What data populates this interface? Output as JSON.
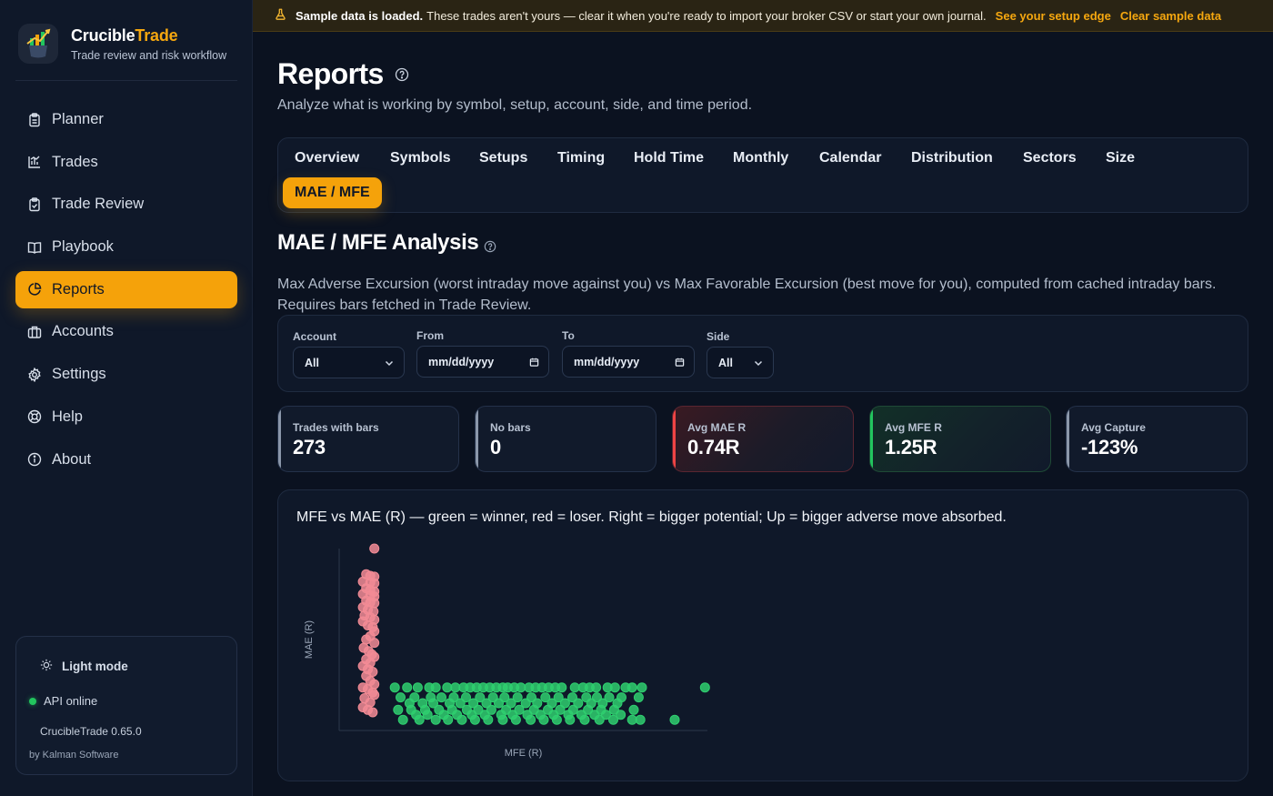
{
  "app": {
    "name_part1": "Crucible",
    "name_part2": "Trade",
    "tagline": "Trade review and risk workflow",
    "accent": "#f5a20a"
  },
  "sidebar": {
    "items": [
      {
        "label": "Planner",
        "icon": "clipboard-icon",
        "active": false
      },
      {
        "label": "Trades",
        "icon": "bar-chart-icon",
        "active": false
      },
      {
        "label": "Trade Review",
        "icon": "clipboard-check-icon",
        "active": false
      },
      {
        "label": "Playbook",
        "icon": "book-icon",
        "active": false
      },
      {
        "label": "Reports",
        "icon": "pie-chart-icon",
        "active": true
      },
      {
        "label": "Accounts",
        "icon": "briefcase-icon",
        "active": false
      },
      {
        "label": "Settings",
        "icon": "gear-icon",
        "active": false
      },
      {
        "label": "Help",
        "icon": "lifebuoy-icon",
        "active": false
      },
      {
        "label": "About",
        "icon": "info-icon",
        "active": false
      }
    ],
    "footer": {
      "light_mode": "Light mode",
      "api_status": "API online",
      "version": "CrucibleTrade 0.65.0",
      "byline": "by Kalman Software"
    }
  },
  "banner": {
    "bold": "Sample data is loaded.",
    "text": "These trades aren't yours — clear it when you're ready to import your broker CSV or start your own journal.",
    "link1": "See your setup edge",
    "link2": "Clear sample data"
  },
  "page": {
    "title": "Reports",
    "subtitle": "Analyze what is working by symbol, setup, account, side, and time period."
  },
  "tabs": [
    {
      "label": "Overview"
    },
    {
      "label": "Symbols"
    },
    {
      "label": "Setups"
    },
    {
      "label": "Timing"
    },
    {
      "label": "Hold Time"
    },
    {
      "label": "Monthly"
    },
    {
      "label": "Calendar"
    },
    {
      "label": "Distribution"
    },
    {
      "label": "Sectors"
    },
    {
      "label": "Size"
    },
    {
      "label": "MAE / MFE",
      "active": true
    }
  ],
  "section": {
    "title": "MAE / MFE Analysis",
    "description": "Max Adverse Excursion (worst intraday move against you) vs Max Favorable Excursion (best move for you), computed from cached intraday bars. Requires bars fetched in Trade Review."
  },
  "filters": {
    "account": {
      "label": "Account",
      "value": "All"
    },
    "from": {
      "label": "From",
      "placeholder": "mm/dd/yyyy"
    },
    "to": {
      "label": "To",
      "placeholder": "mm/dd/yyyy"
    },
    "side": {
      "label": "Side",
      "value": "All"
    }
  },
  "stats": [
    {
      "label": "Trades with bars",
      "value": "273",
      "tone": "neutral"
    },
    {
      "label": "No bars",
      "value": "0",
      "tone": "neutral"
    },
    {
      "label": "Avg MAE R",
      "value": "0.74R",
      "tone": "red"
    },
    {
      "label": "Avg MFE R",
      "value": "1.25R",
      "tone": "green"
    },
    {
      "label": "Avg Capture",
      "value": "-123%",
      "tone": "neutral"
    }
  ],
  "chart_data": {
    "type": "scatter",
    "title": "MFE vs MAE (R) — green = winner, red = loser. Right = bigger potential; Up = bigger adverse move absorbed.",
    "xlabel": "MFE (R)",
    "ylabel": "MAE (R)",
    "xlim": [
      0,
      4.5
    ],
    "ylim": [
      0,
      2.2
    ],
    "grid": false,
    "legend": "none",
    "series": [
      {
        "color": "#f28b95",
        "points": [
          [
            0.43,
            2.2
          ],
          [
            0.33,
            1.89
          ],
          [
            0.38,
            1.87
          ],
          [
            0.43,
            1.86
          ],
          [
            0.29,
            1.8
          ],
          [
            0.38,
            1.79
          ],
          [
            0.43,
            1.78
          ],
          [
            0.33,
            1.72
          ],
          [
            0.38,
            1.7
          ],
          [
            0.43,
            1.68
          ],
          [
            0.29,
            1.65
          ],
          [
            0.38,
            1.63
          ],
          [
            0.43,
            1.62
          ],
          [
            0.33,
            1.57
          ],
          [
            0.38,
            1.55
          ],
          [
            0.43,
            1.54
          ],
          [
            0.29,
            1.49
          ],
          [
            0.35,
            1.46
          ],
          [
            0.42,
            1.44
          ],
          [
            0.31,
            1.39
          ],
          [
            0.38,
            1.37
          ],
          [
            0.43,
            1.34
          ],
          [
            0.29,
            1.32
          ],
          [
            0.35,
            1.27
          ],
          [
            0.41,
            1.25
          ],
          [
            0.43,
            1.2
          ],
          [
            0.38,
            1.14
          ],
          [
            0.33,
            1.1
          ],
          [
            0.43,
            1.06
          ],
          [
            0.3,
            1.0
          ],
          [
            0.36,
            0.96
          ],
          [
            0.4,
            0.92
          ],
          [
            0.43,
            0.89
          ],
          [
            0.33,
            0.86
          ],
          [
            0.38,
            0.82
          ],
          [
            0.29,
            0.78
          ],
          [
            0.35,
            0.74
          ],
          [
            0.41,
            0.71
          ],
          [
            0.33,
            0.66
          ],
          [
            0.38,
            0.6
          ],
          [
            0.43,
            0.56
          ],
          [
            0.29,
            0.52
          ],
          [
            0.35,
            0.5
          ],
          [
            0.41,
            0.46
          ],
          [
            0.43,
            0.43
          ],
          [
            0.31,
            0.39
          ],
          [
            0.38,
            0.34
          ],
          [
            0.29,
            0.28
          ],
          [
            0.35,
            0.25
          ],
          [
            0.41,
            0.22
          ]
        ]
      },
      {
        "color": "#2fce6f",
        "points": [
          [
            0.68,
            0.52
          ],
          [
            0.83,
            0.52
          ],
          [
            0.96,
            0.52
          ],
          [
            1.1,
            0.52
          ],
          [
            1.18,
            0.52
          ],
          [
            1.32,
            0.52
          ],
          [
            1.42,
            0.52
          ],
          [
            1.52,
            0.52
          ],
          [
            1.6,
            0.52
          ],
          [
            1.68,
            0.52
          ],
          [
            1.76,
            0.52
          ],
          [
            1.84,
            0.52
          ],
          [
            1.92,
            0.52
          ],
          [
            2.0,
            0.52
          ],
          [
            2.06,
            0.52
          ],
          [
            2.14,
            0.52
          ],
          [
            2.22,
            0.52
          ],
          [
            2.32,
            0.52
          ],
          [
            2.4,
            0.52
          ],
          [
            2.48,
            0.52
          ],
          [
            2.56,
            0.52
          ],
          [
            2.64,
            0.52
          ],
          [
            2.72,
            0.52
          ],
          [
            2.88,
            0.52
          ],
          [
            2.98,
            0.52
          ],
          [
            3.06,
            0.52
          ],
          [
            3.14,
            0.52
          ],
          [
            3.28,
            0.52
          ],
          [
            3.37,
            0.52
          ],
          [
            3.5,
            0.52
          ],
          [
            3.58,
            0.52
          ],
          [
            3.7,
            0.52
          ],
          [
            4.47,
            0.52
          ],
          [
            0.75,
            0.4
          ],
          [
            0.92,
            0.4
          ],
          [
            1.12,
            0.4
          ],
          [
            1.25,
            0.4
          ],
          [
            1.4,
            0.4
          ],
          [
            1.55,
            0.4
          ],
          [
            1.72,
            0.4
          ],
          [
            1.88,
            0.4
          ],
          [
            2.02,
            0.4
          ],
          [
            2.18,
            0.4
          ],
          [
            2.35,
            0.4
          ],
          [
            2.52,
            0.4
          ],
          [
            2.68,
            0.4
          ],
          [
            2.85,
            0.4
          ],
          [
            3.02,
            0.4
          ],
          [
            3.15,
            0.4
          ],
          [
            3.3,
            0.4
          ],
          [
            3.45,
            0.4
          ],
          [
            3.66,
            0.4
          ],
          [
            0.86,
            0.33
          ],
          [
            1.02,
            0.33
          ],
          [
            1.15,
            0.33
          ],
          [
            1.35,
            0.33
          ],
          [
            1.48,
            0.33
          ],
          [
            1.64,
            0.33
          ],
          [
            1.8,
            0.33
          ],
          [
            1.95,
            0.33
          ],
          [
            2.1,
            0.33
          ],
          [
            2.28,
            0.33
          ],
          [
            2.42,
            0.33
          ],
          [
            2.6,
            0.33
          ],
          [
            2.76,
            0.33
          ],
          [
            2.92,
            0.33
          ],
          [
            3.08,
            0.33
          ],
          [
            3.22,
            0.33
          ],
          [
            3.4,
            0.33
          ],
          [
            0.72,
            0.25
          ],
          [
            0.88,
            0.25
          ],
          [
            1.05,
            0.25
          ],
          [
            1.22,
            0.25
          ],
          [
            1.38,
            0.25
          ],
          [
            1.56,
            0.25
          ],
          [
            1.7,
            0.25
          ],
          [
            1.86,
            0.25
          ],
          [
            2.04,
            0.25
          ],
          [
            2.2,
            0.25
          ],
          [
            2.38,
            0.25
          ],
          [
            2.55,
            0.25
          ],
          [
            2.7,
            0.25
          ],
          [
            2.86,
            0.25
          ],
          [
            3.04,
            0.25
          ],
          [
            3.2,
            0.25
          ],
          [
            3.36,
            0.25
          ],
          [
            3.6,
            0.25
          ],
          [
            0.94,
            0.19
          ],
          [
            1.08,
            0.19
          ],
          [
            1.28,
            0.19
          ],
          [
            1.44,
            0.19
          ],
          [
            1.62,
            0.19
          ],
          [
            1.78,
            0.19
          ],
          [
            1.98,
            0.19
          ],
          [
            2.12,
            0.19
          ],
          [
            2.3,
            0.19
          ],
          [
            2.46,
            0.19
          ],
          [
            2.62,
            0.19
          ],
          [
            2.8,
            0.19
          ],
          [
            2.96,
            0.19
          ],
          [
            3.12,
            0.19
          ],
          [
            3.26,
            0.19
          ],
          [
            3.44,
            0.19
          ],
          [
            0.78,
            0.13
          ],
          [
            0.98,
            0.13
          ],
          [
            1.18,
            0.13
          ],
          [
            1.33,
            0.13
          ],
          [
            1.5,
            0.13
          ],
          [
            1.66,
            0.13
          ],
          [
            1.82,
            0.13
          ],
          [
            2.0,
            0.13
          ],
          [
            2.16,
            0.13
          ],
          [
            2.34,
            0.13
          ],
          [
            2.5,
            0.13
          ],
          [
            2.66,
            0.13
          ],
          [
            2.82,
            0.13
          ],
          [
            3.0,
            0.13
          ],
          [
            3.18,
            0.13
          ],
          [
            3.35,
            0.13
          ],
          [
            3.58,
            0.13
          ],
          [
            3.68,
            0.13
          ],
          [
            4.1,
            0.13
          ]
        ]
      }
    ]
  }
}
